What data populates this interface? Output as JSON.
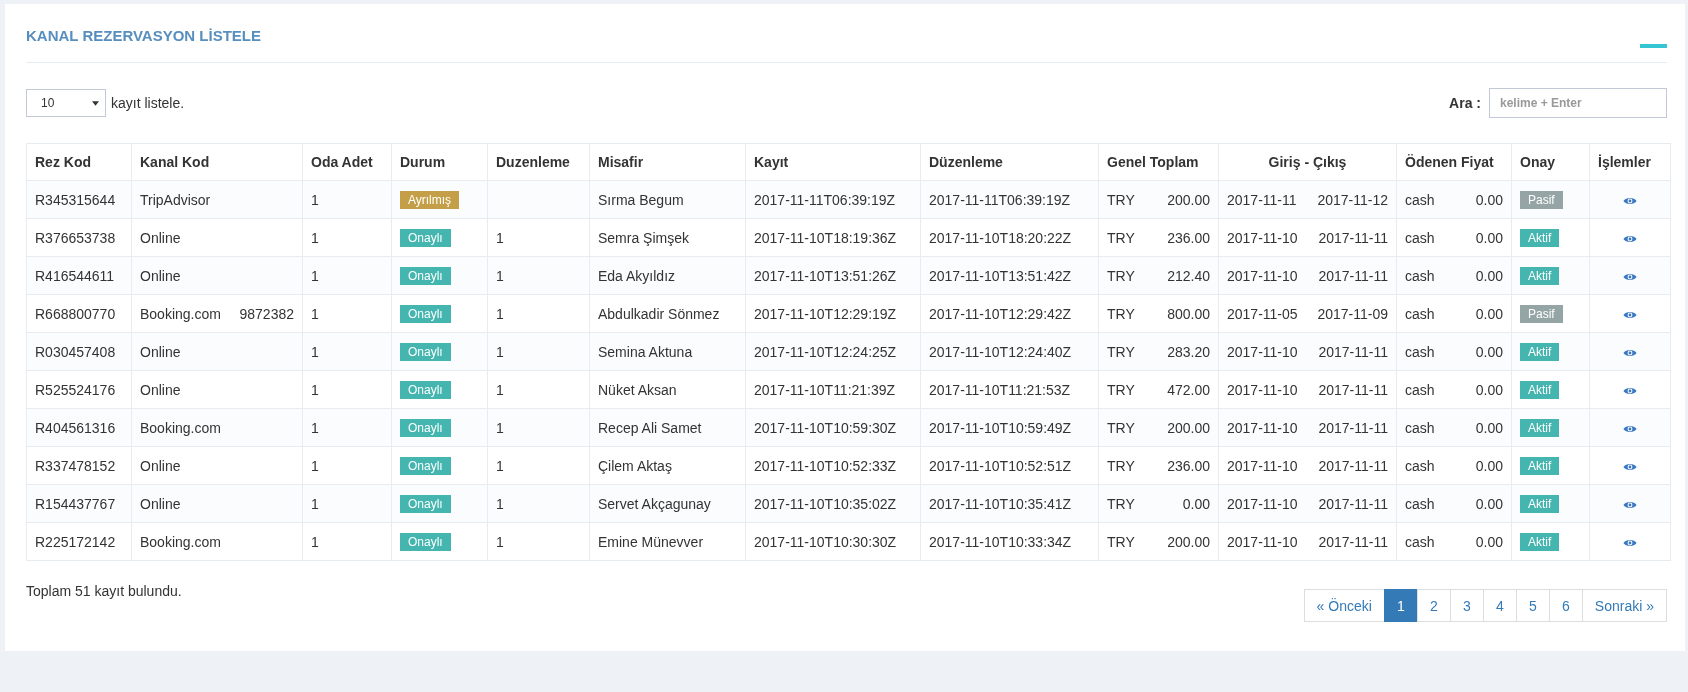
{
  "panel": {
    "title": "KANAL REZERVASYON LİSTELE"
  },
  "page_size": {
    "value": "10",
    "label": "kayıt listele."
  },
  "search": {
    "label": "Ara :",
    "placeholder": "kelime + Enter"
  },
  "table": {
    "columns": [
      "Rez Kod",
      "Kanal Kod",
      "Oda Adet",
      "Durum",
      "Duzenleme",
      "Misafir",
      "Kayıt",
      "Düzenleme",
      "Genel Toplam",
      "Giriş - Çıkış",
      "Ödenen Fiyat",
      "Onay",
      "İşlemler"
    ],
    "rows": [
      {
        "rez_kod": "R345315644",
        "kanal_kod": "TripAdvisor",
        "oda_adet": "1",
        "durum": {
          "label": "Ayrılmış",
          "kind": "reserved"
        },
        "misafir": "Sırma Begum",
        "kayit": "2017-11-11T06:39:19Z",
        "duzenleme_tarihi": "2017-11-11T06:39:19Z",
        "currency": "TRY",
        "total": "200.00",
        "giris": "2017-11-11",
        "cikis": "2017-11-12",
        "payment": "cash",
        "paid": "0.00",
        "onay": {
          "label": "Pasif",
          "active": false
        }
      },
      {
        "rez_kod": "R376653738",
        "kanal_kod": "Online",
        "oda_adet": "1",
        "durum": {
          "label": "Onaylı",
          "kind": "approved"
        },
        "duzenleme": "1",
        "misafir": "Semra Şimşek",
        "kayit": "2017-11-10T18:19:36Z",
        "duzenleme_tarihi": "2017-11-10T18:20:22Z",
        "currency": "TRY",
        "total": "236.00",
        "giris": "2017-11-10",
        "cikis": "2017-11-11",
        "payment": "cash",
        "paid": "0.00",
        "onay": {
          "label": "Aktif",
          "active": true
        }
      },
      {
        "rez_kod": "R416544611",
        "kanal_kod": "Online",
        "oda_adet": "1",
        "durum": {
          "label": "Onaylı",
          "kind": "approved"
        },
        "duzenleme": "1",
        "misafir": "Eda Akyıldız",
        "kayit": "2017-11-10T13:51:26Z",
        "duzenleme_tarihi": "2017-11-10T13:51:42Z",
        "currency": "TRY",
        "total": "212.40",
        "giris": "2017-11-10",
        "cikis": "2017-11-11",
        "payment": "cash",
        "paid": "0.00",
        "onay": {
          "label": "Aktif",
          "active": true
        }
      },
      {
        "rez_kod": "R668800770",
        "kanal_kod": "Booking.com",
        "kanal_ref": "9872382",
        "oda_adet": "1",
        "durum": {
          "label": "Onaylı",
          "kind": "approved"
        },
        "duzenleme": "1",
        "misafir": "Abdulkadir Sönmez",
        "kayit": "2017-11-10T12:29:19Z",
        "duzenleme_tarihi": "2017-11-10T12:29:42Z",
        "currency": "TRY",
        "total": "800.00",
        "giris": "2017-11-05",
        "cikis": "2017-11-09",
        "payment": "cash",
        "paid": "0.00",
        "onay": {
          "label": "Pasif",
          "active": false
        }
      },
      {
        "rez_kod": "R030457408",
        "kanal_kod": "Online",
        "oda_adet": "1",
        "durum": {
          "label": "Onaylı",
          "kind": "approved"
        },
        "duzenleme": "1",
        "misafir": "Semina Aktuna",
        "kayit": "2017-11-10T12:24:25Z",
        "duzenleme_tarihi": "2017-11-10T12:24:40Z",
        "currency": "TRY",
        "total": "283.20",
        "giris": "2017-11-10",
        "cikis": "2017-11-11",
        "payment": "cash",
        "paid": "0.00",
        "onay": {
          "label": "Aktif",
          "active": true
        }
      },
      {
        "rez_kod": "R525524176",
        "kanal_kod": "Online",
        "oda_adet": "1",
        "durum": {
          "label": "Onaylı",
          "kind": "approved"
        },
        "duzenleme": "1",
        "misafir": "Nüket Aksan",
        "kayit": "2017-11-10T11:21:39Z",
        "duzenleme_tarihi": "2017-11-10T11:21:53Z",
        "currency": "TRY",
        "total": "472.00",
        "giris": "2017-11-10",
        "cikis": "2017-11-11",
        "payment": "cash",
        "paid": "0.00",
        "onay": {
          "label": "Aktif",
          "active": true
        }
      },
      {
        "rez_kod": "R404561316",
        "kanal_kod": "Booking.com",
        "oda_adet": "1",
        "durum": {
          "label": "Onaylı",
          "kind": "approved"
        },
        "duzenleme": "1",
        "misafir": "Recep Ali Samet",
        "kayit": "2017-11-10T10:59:30Z",
        "duzenleme_tarihi": "2017-11-10T10:59:49Z",
        "currency": "TRY",
        "total": "200.00",
        "giris": "2017-11-10",
        "cikis": "2017-11-11",
        "payment": "cash",
        "paid": "0.00",
        "onay": {
          "label": "Aktif",
          "active": true
        }
      },
      {
        "rez_kod": "R337478152",
        "kanal_kod": "Online",
        "oda_adet": "1",
        "durum": {
          "label": "Onaylı",
          "kind": "approved"
        },
        "duzenleme": "1",
        "misafir": "Çilem Aktaş",
        "kayit": "2017-11-10T10:52:33Z",
        "duzenleme_tarihi": "2017-11-10T10:52:51Z",
        "currency": "TRY",
        "total": "236.00",
        "giris": "2017-11-10",
        "cikis": "2017-11-11",
        "payment": "cash",
        "paid": "0.00",
        "onay": {
          "label": "Aktif",
          "active": true
        }
      },
      {
        "rez_kod": "R154437767",
        "kanal_kod": "Online",
        "oda_adet": "1",
        "durum": {
          "label": "Onaylı",
          "kind": "approved"
        },
        "duzenleme": "1",
        "misafir": "Servet Akçagunay",
        "kayit": "2017-11-10T10:35:02Z",
        "duzenleme_tarihi": "2017-11-10T10:35:41Z",
        "currency": "TRY",
        "total": "0.00",
        "giris": "2017-11-10",
        "cikis": "2017-11-11",
        "payment": "cash",
        "paid": "0.00",
        "onay": {
          "label": "Aktif",
          "active": true
        }
      },
      {
        "rez_kod": "R225172142",
        "kanal_kod": "Booking.com",
        "oda_adet": "1",
        "durum": {
          "label": "Onaylı",
          "kind": "approved"
        },
        "duzenleme": "1",
        "misafir": "Emine Münevver",
        "kayit": "2017-11-10T10:30:30Z",
        "duzenleme_tarihi": "2017-11-10T10:33:34Z",
        "currency": "TRY",
        "total": "200.00",
        "giris": "2017-11-10",
        "cikis": "2017-11-11",
        "payment": "cash",
        "paid": "0.00",
        "onay": {
          "label": "Aktif",
          "active": true
        }
      }
    ]
  },
  "summary": "Toplam 51 kayıt bulundu.",
  "pagination": {
    "previous": "« Önceki",
    "next": "Sonraki »",
    "pages": [
      {
        "label": "1",
        "selected": true
      },
      {
        "label": "2",
        "selected": false
      },
      {
        "label": "3",
        "selected": false
      },
      {
        "label": "4",
        "selected": false
      },
      {
        "label": "5",
        "selected": false
      },
      {
        "label": "6",
        "selected": false
      }
    ]
  }
}
